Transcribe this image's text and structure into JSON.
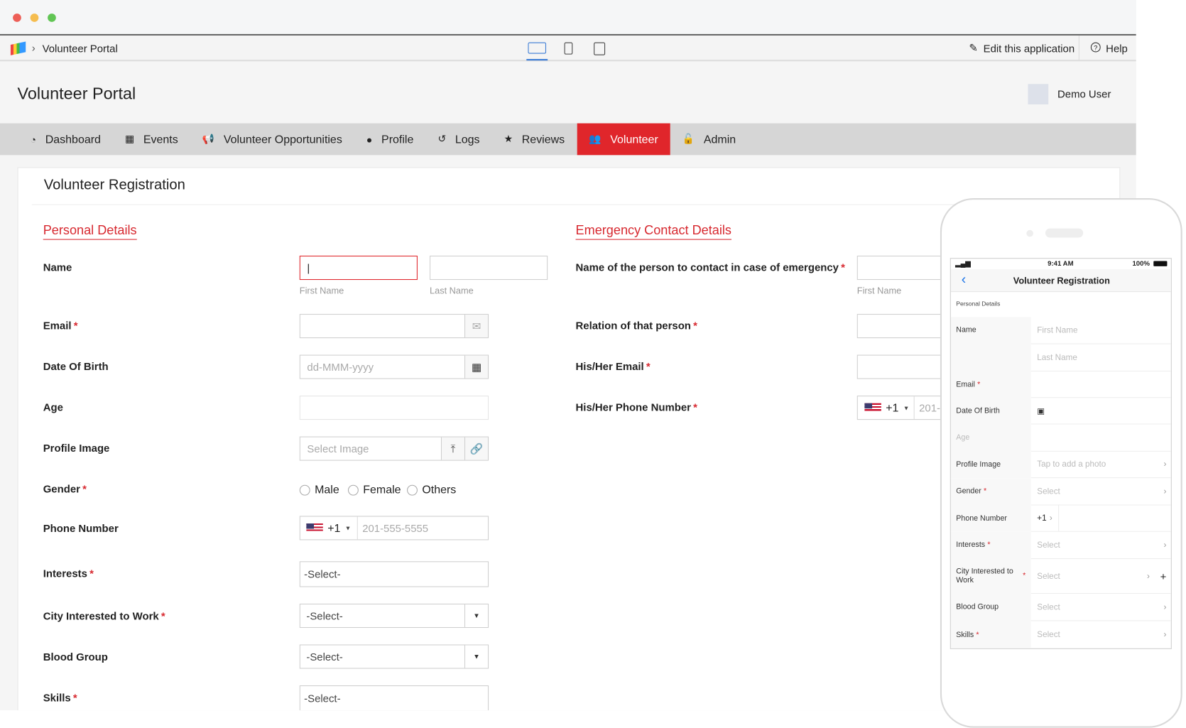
{
  "window": {
    "controls": [
      "close",
      "minimize",
      "maximize"
    ]
  },
  "appbar": {
    "breadcrumb": "Volunteer Portal",
    "edit": "Edit this application",
    "help": "Help",
    "devices": [
      "laptop-icon",
      "tablet-portrait-icon",
      "tablet-icon"
    ]
  },
  "header": {
    "title": "Volunteer Portal",
    "user": "Demo User"
  },
  "nav": [
    {
      "label": "Dashboard",
      "icon": "dashboard-icon"
    },
    {
      "label": "Events",
      "icon": "calendar-icon"
    },
    {
      "label": "Volunteer Opportunities",
      "icon": "megaphone-icon"
    },
    {
      "label": "Profile",
      "icon": "user-icon"
    },
    {
      "label": "Logs",
      "icon": "history-icon"
    },
    {
      "label": "Reviews",
      "icon": "star-icon"
    },
    {
      "label": "Volunteer",
      "icon": "group-icon",
      "active": true
    },
    {
      "label": "Admin",
      "icon": "lock-icon"
    }
  ],
  "form": {
    "title": "Volunteer Registration",
    "personal": {
      "heading": "Personal Details",
      "name": "Name",
      "first": "First Name",
      "last": "Last Name",
      "email": "Email",
      "dob": "Date Of Birth",
      "dob_ph": "dd-MMM-yyyy",
      "age": "Age",
      "profile": "Profile Image",
      "profile_ph": "Select Image",
      "gender": "Gender",
      "genders": [
        "Male",
        "Female",
        "Others"
      ],
      "phone": "Phone Number",
      "code": "+1",
      "phone_ph": "201-555-5555",
      "interests": "Interests",
      "city": "City Interested to Work",
      "blood": "Blood Group",
      "skills": "Skills",
      "select": "-Select-"
    },
    "emergency": {
      "heading": "Emergency Contact Details",
      "name": "Name of the person to contact in case of emergency",
      "first": "First Name",
      "relation": "Relation of that person",
      "email": "His/Her Email",
      "phone": "His/Her Phone Number",
      "code": "+1",
      "phone_ph": "201-"
    }
  },
  "mobile": {
    "time": "9:41 AM",
    "battery": "100%",
    "title": "Volunteer Registration",
    "section": "Personal Details",
    "rows": [
      {
        "label": "Name",
        "value": "First Name"
      },
      {
        "label": "",
        "value": "Last Name"
      },
      {
        "label": "Email",
        "req": true,
        "value": ""
      },
      {
        "label": "Date Of Birth",
        "value": "",
        "icon": "calendar"
      },
      {
        "label": "Age",
        "value": "",
        "muted": true
      },
      {
        "label": "Profile Image",
        "value": "Tap to add a photo",
        "chev": true
      },
      {
        "label": "Gender",
        "req": true,
        "value": "Select",
        "chev": true
      },
      {
        "label": "Phone Number",
        "value": "+1",
        "phone": true
      },
      {
        "label": "Interests",
        "req": true,
        "value": "Select",
        "chev": true
      },
      {
        "label": "City Interested to Work",
        "req": true,
        "value": "Select",
        "chev": true,
        "plus": true
      },
      {
        "label": "Blood Group",
        "value": "Select",
        "chev": true
      },
      {
        "label": "Skills",
        "req": true,
        "value": "Select",
        "chev": true
      }
    ]
  },
  "colors": {
    "accent": "#e0262b",
    "link": "#1a73e8"
  }
}
